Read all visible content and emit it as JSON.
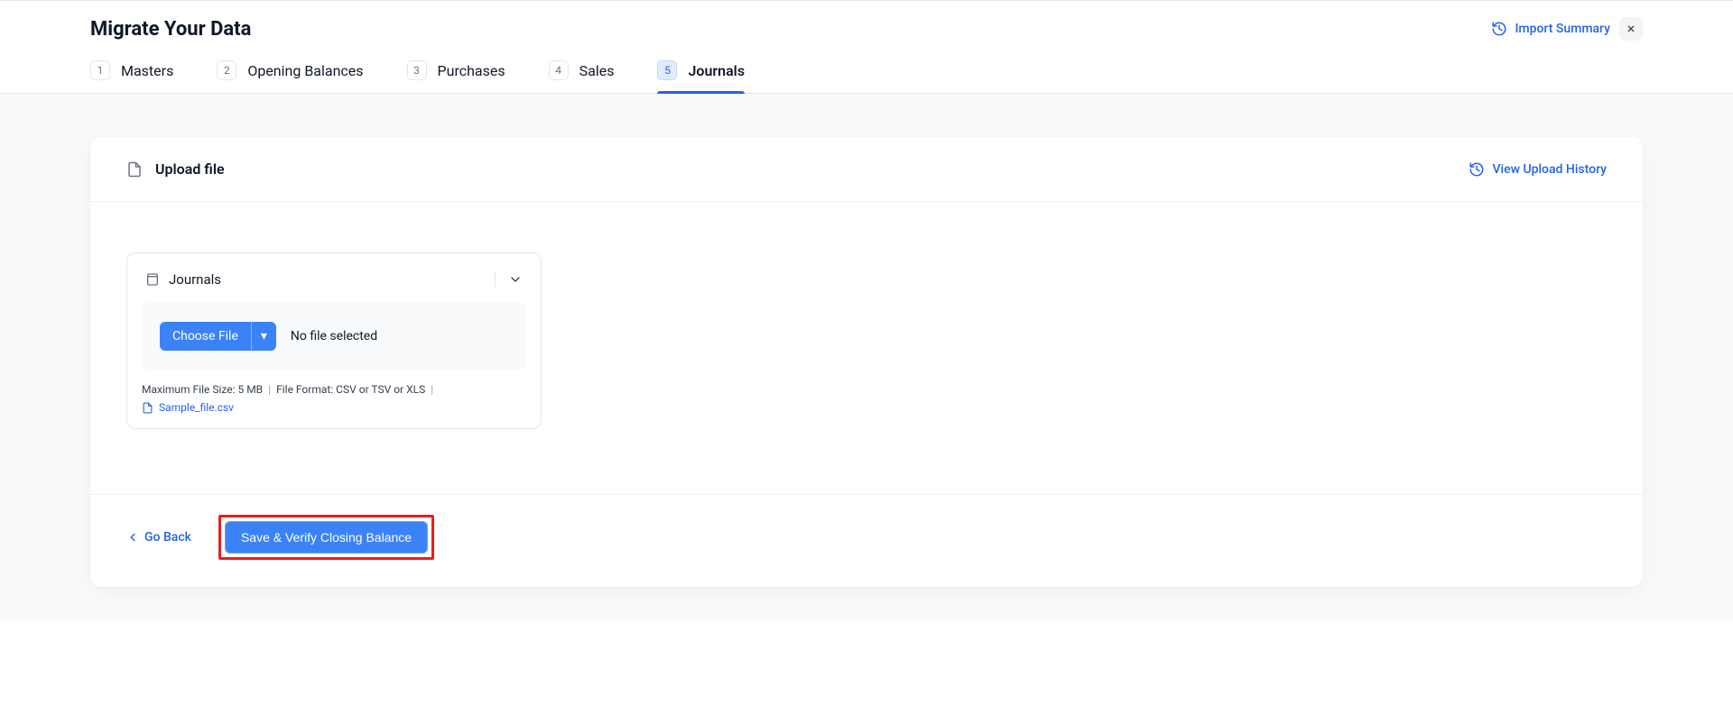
{
  "header": {
    "title": "Migrate Your Data",
    "import_summary_label": "Import Summary",
    "close_glyph": "×"
  },
  "tabs": [
    {
      "num": "1",
      "label": "Masters",
      "active": false
    },
    {
      "num": "2",
      "label": "Opening Balances",
      "active": false
    },
    {
      "num": "3",
      "label": "Purchases",
      "active": false
    },
    {
      "num": "4",
      "label": "Sales",
      "active": false
    },
    {
      "num": "5",
      "label": "Journals",
      "active": true
    }
  ],
  "card": {
    "title": "Upload file",
    "history_label": "View Upload History"
  },
  "panel": {
    "title": "Journals",
    "choose_file_label": "Choose File",
    "choose_file_caret": "▾",
    "no_file_label": "No file selected",
    "max_size_label": "Maximum File Size: 5 MB",
    "file_format_label": "File Format: CSV or TSV or XLS",
    "sample_link_label": "Sample_file.csv"
  },
  "footer": {
    "go_back_label": "Go Back",
    "save_label": "Save & Verify Closing Balance"
  }
}
